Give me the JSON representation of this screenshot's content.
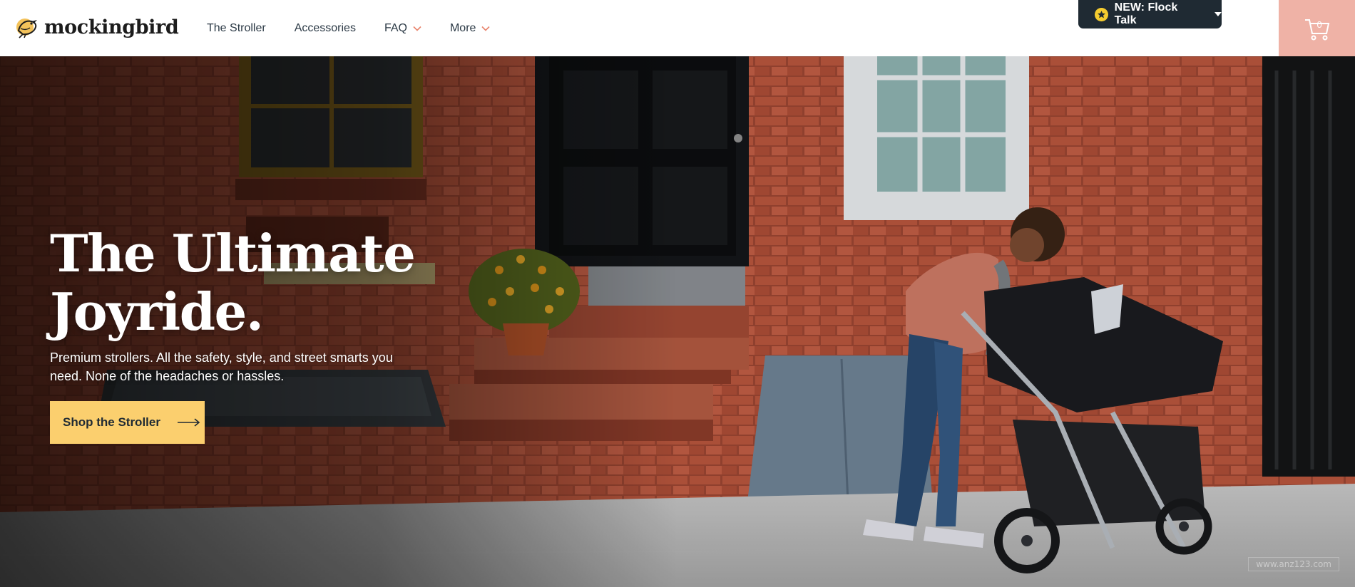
{
  "brand": {
    "name": "mockingbird",
    "logo_icon": "bird-icon"
  },
  "nav": {
    "items": [
      {
        "label": "The Stroller",
        "has_dropdown": false
      },
      {
        "label": "Accessories",
        "has_dropdown": false
      },
      {
        "label": "FAQ",
        "has_dropdown": true
      },
      {
        "label": "More",
        "has_dropdown": true
      }
    ]
  },
  "promo": {
    "label": "NEW: Flock Talk",
    "icon": "star-icon"
  },
  "cart": {
    "count": "0",
    "icon": "cart-icon"
  },
  "hero": {
    "title_line1": "The Ultimate",
    "title_line2": "Joyride.",
    "subtitle": "Premium strollers. All the safety, style, and street smarts you need. None of the headaches or hassles.",
    "cta_label": "Shop the Stroller",
    "cta_icon": "arrow-right-icon"
  },
  "watermark": "www.anz123.com",
  "colors": {
    "header_bg": "#ffffff",
    "promo_bg": "#1f2a33",
    "star": "#f5cc2f",
    "cart_bg": "#efb2a6",
    "cta_bg": "#fbcf6e",
    "chevron": "#e8836c",
    "text_dark": "#1f2a33"
  }
}
